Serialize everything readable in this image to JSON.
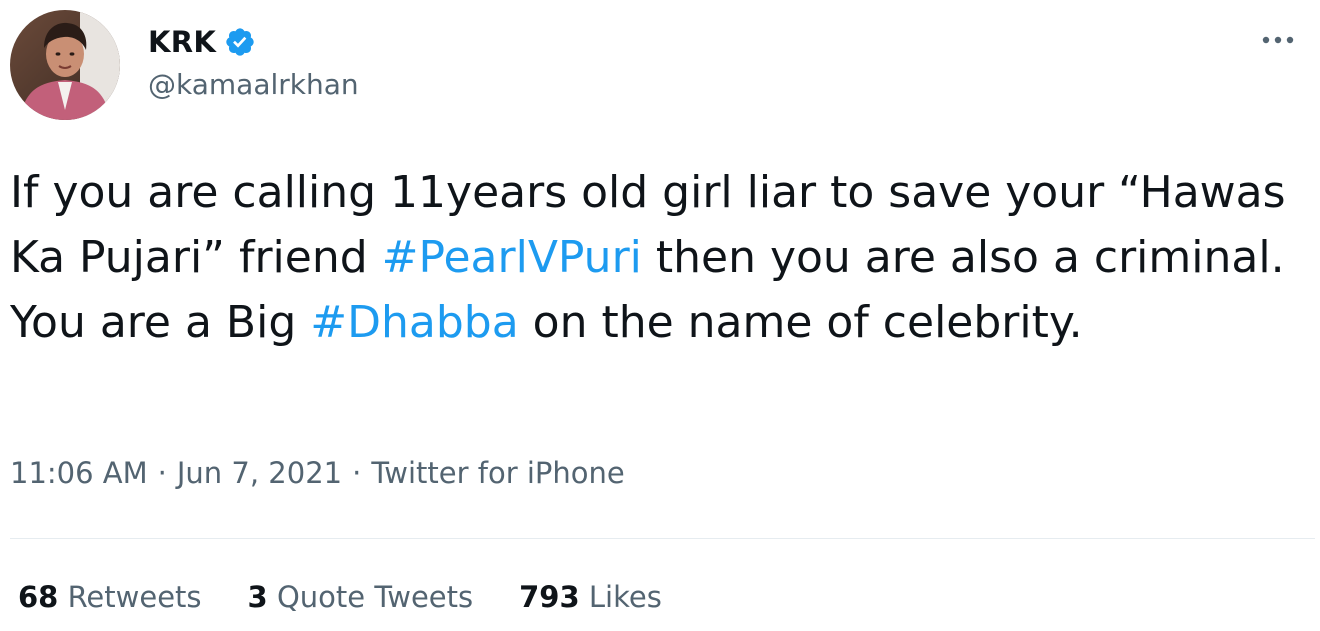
{
  "author": {
    "display_name": "KRK",
    "handle": "@kamaalrkhan",
    "verified": true,
    "avatar_icon": "profile-photo"
  },
  "tweet": {
    "text_parts": [
      "If you are calling 11years old girl liar to save your “Hawas Ka Pujari” friend ",
      " then you are also a criminal. You are a Big ",
      " on the name of celebrity."
    ],
    "hashtags": [
      "#PearlVPuri",
      "#Dhabba"
    ]
  },
  "meta": {
    "time": "11:06 AM",
    "separator": "·",
    "date": "Jun 7, 2021",
    "source": "Twitter for iPhone"
  },
  "stats": {
    "retweets": {
      "count": "68",
      "label": "Retweets"
    },
    "quotes": {
      "count": "3",
      "label": "Quote Tweets"
    },
    "likes": {
      "count": "793",
      "label": "Likes"
    }
  },
  "colors": {
    "accent": "#1d9bf0",
    "text": "#0f1419",
    "secondary": "#536471",
    "divider": "#e6ecf0"
  },
  "icons": {
    "verified": "verified-badge-icon",
    "more": "more-options-icon"
  }
}
